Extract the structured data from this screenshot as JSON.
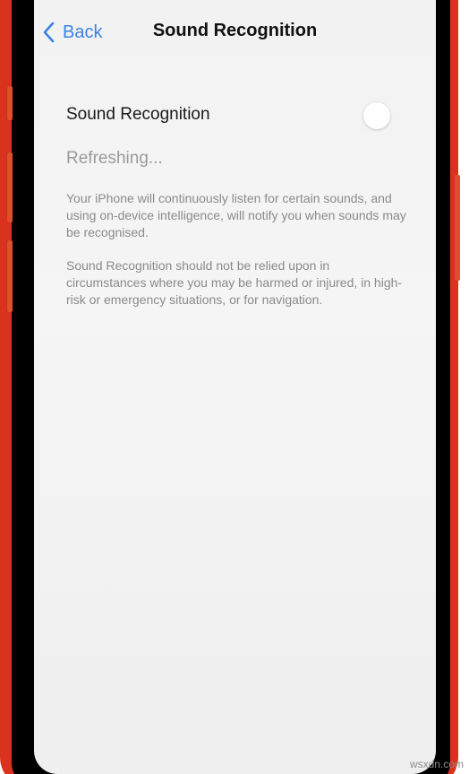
{
  "navbar": {
    "back_label": "Back",
    "title": "Sound Recognition"
  },
  "settings": {
    "toggle_label": "Sound Recognition",
    "toggle_state": "off",
    "status": "Refreshing...",
    "description_1": "Your iPhone will continuously listen for certain sounds, and using on-device intelligence, will notify you when sounds may be recognised.",
    "description_2": "Sound Recognition should not be relied upon in circumstances where you may be harmed or injured, in high-risk or emergency situations, or for navigation."
  },
  "watermark": "wsxdn.com",
  "colors": {
    "frame": "#d9331e",
    "link": "#3a82e4",
    "screen_bg": "#f2f2f2"
  },
  "icons": {
    "back": "chevron-left-icon"
  }
}
